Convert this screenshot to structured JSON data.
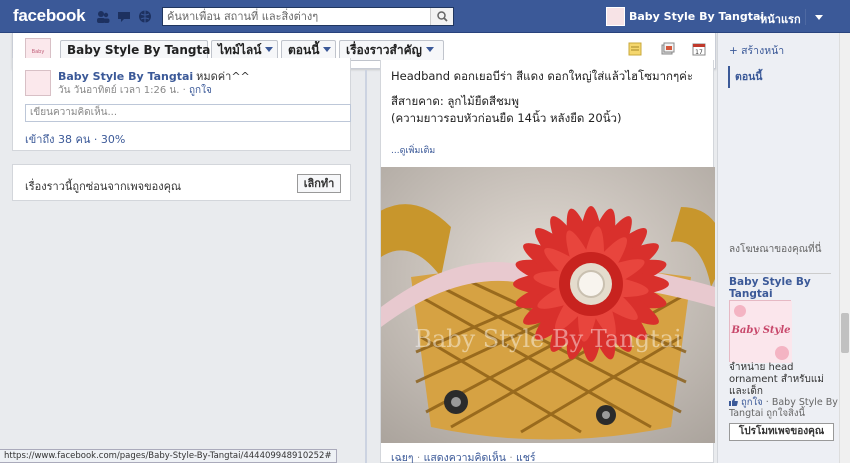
{
  "topbar": {
    "logo": "facebook",
    "search_placeholder": "ค้นหาเพื่อน สถานที่ และสิ่งต่างๆ",
    "profile_name": "Baby Style By Tangtai",
    "home_label": "หน้าแรก",
    "brand_color": "#3b5998"
  },
  "timeline_bar": {
    "page_name": "Baby Style By Tangtai",
    "timeline_label": "ไทม์ไลน์",
    "now_label": "ตอนนี้",
    "highlights_label": "เรื่องราวสำคัญ"
  },
  "post": {
    "author": "Baby Style By Tangtai",
    "message": "หมดค่า^^",
    "time": "วัน วันอาทิตย์ เวลา 1:26 น.",
    "like": "ถูกใจ",
    "comment_placeholder": "เขียนความคิดเห็น...",
    "reach": "เข้าถึง 38 คน",
    "reach_pct": "30%"
  },
  "hidden_story": {
    "text": "เรื่องราวนี้ถูกซ่อนจากเพจของคุณ",
    "undo": "เลิกทำ"
  },
  "photo_post": {
    "line1": "Headband ดอกเยอบีร่า สีแดง ดอกใหญ่ใส่แล้วไฮโซมากๆค่ะ",
    "line2": "สีสายคาด: ลูกไม้ยืดสีชมพู",
    "line3": "(ความยาวรอบหัวก่อนยืด 14นิ้ว หลังยืด 20นิ้ว)",
    "more": "...ดูเพิ่มเติม",
    "watermark": "Baby Style By Tangtai",
    "action_like": "เฉยๆ",
    "action_comment": "แสดงความคิดเห็น",
    "action_share": "แชร์"
  },
  "sidebar": {
    "create_page": "+ สร้างหน้า",
    "now": "ตอนนี้",
    "ad_section": "ลงโฆษณาของคุณที่นี่",
    "ad_title": "Baby Style By Tangtai",
    "ad_image_label": "Baby Style",
    "ad_text": "จำหน่าย head ornament สำหรับแม่และเด็ก",
    "ad_like_link": "ถูกใจ",
    "ad_like_text": "· Baby Style By Tangtai ถูกใจสิ่งนี้",
    "promote": "โปรโมทเพจของคุณ"
  },
  "statusbar": {
    "url": "https://www.facebook.com/pages/Baby-Style-By-Tangtai/444409948910252#"
  }
}
